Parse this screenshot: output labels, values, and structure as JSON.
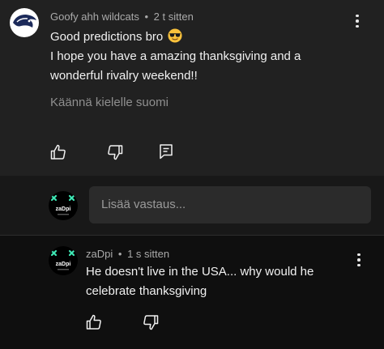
{
  "comment": {
    "author": "Goofy ahh wildcats",
    "separator": "•",
    "time": "2 t sitten",
    "line1": "Good predictions bro",
    "line2": "I hope you have a amazing thanksgiving and a",
    "line3": "wonderful rivalry weekend!!",
    "emoji": "sunglasses-face-emoji",
    "translate_label": "Käännä kielelle suomi",
    "actions": [
      "thumbs-up-icon",
      "thumbs-down-icon",
      "reply-icon"
    ]
  },
  "reply_box": {
    "placeholder": "Lisää vastaus...",
    "avatar_text": "zaDpi"
  },
  "reply": {
    "author": "zaDpi",
    "separator": "•",
    "time": "1 s sitten",
    "line1": "He doesn't live in the USA... why would he",
    "line2": "celebrate thanksgiving",
    "avatar_text": "zaDpi",
    "actions": [
      "thumbs-up-icon",
      "thumbs-down-icon"
    ]
  },
  "colors": {
    "comment_bg": "#212121",
    "page_bg": "#0f0f0f",
    "input_bg": "#2b2b2b",
    "avatar_accent": "#3ee6b4"
  }
}
